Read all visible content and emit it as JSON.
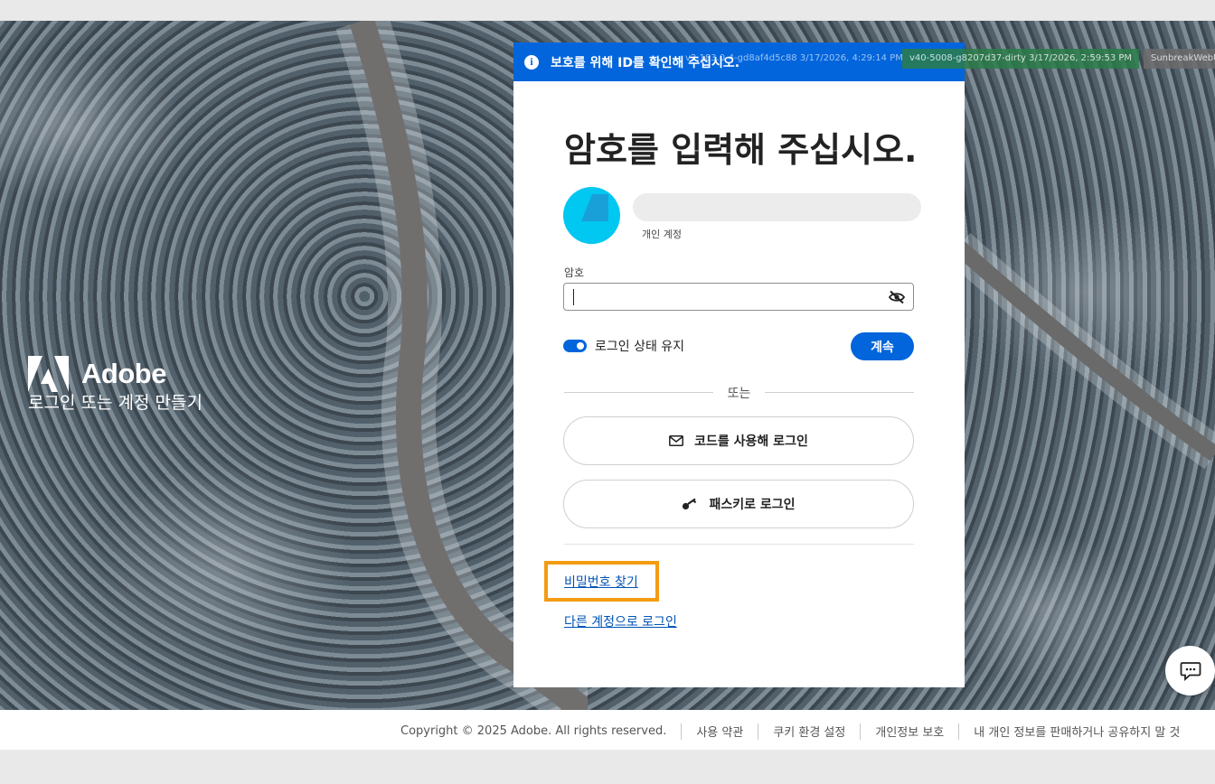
{
  "brand": {
    "name": "Adobe",
    "tagline": "로그인 또는 계정 만들기"
  },
  "banner": {
    "icon": "info-icon",
    "text": "보호를 위해 ID를 확인해 주십시오.",
    "color": "#0265dc"
  },
  "debug": {
    "build1": "v2.183.0-4-gd8af4d5c88 3/17/2026, 4:29:14 PM",
    "build2": "v40-5008-g8207d37-dirty 3/17/2026, 2:59:53 PM",
    "build3": "SunbreakWebUI"
  },
  "form": {
    "title": "암호를 입력해 주십시오.",
    "account_type": "개인 계정",
    "password_label": "암호",
    "password_value": "",
    "keep_signed_in_label": "로그인 상태 유지",
    "keep_signed_in": true,
    "continue_label": "계속",
    "or_label": "또는",
    "code_login_label": "코드를 사용해 로그인",
    "passkey_login_label": "패스키로 로그인",
    "forgot_password_label": "비밀번호 찾기",
    "other_account_label": "다른 계정으로 로그인"
  },
  "footer": {
    "copyright": "Copyright © 2025 Adobe. All rights reserved.",
    "links": [
      "사용 약관",
      "쿠키 환경 설정",
      "개인정보 보호",
      "내 개인 정보를 판매하거나 공유하지 말 것"
    ]
  },
  "colors": {
    "accent": "#0265dc",
    "highlight": "#f39c12"
  }
}
